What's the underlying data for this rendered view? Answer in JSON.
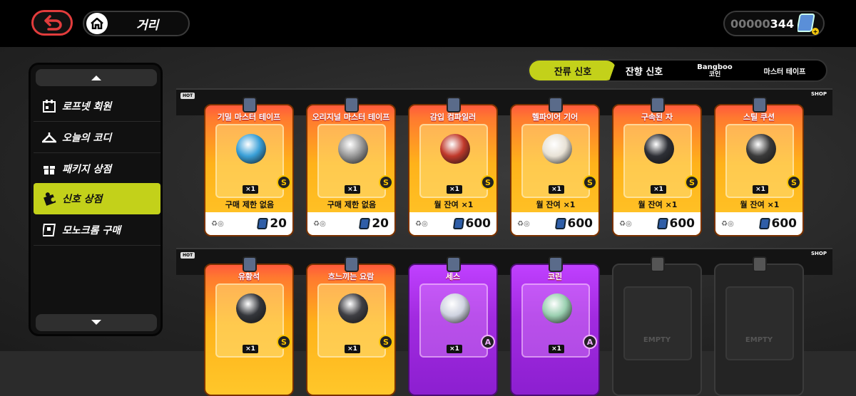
{
  "header": {
    "location": "거리",
    "currency_zeros": "00000",
    "currency_value": "344"
  },
  "sidebar": {
    "items": [
      {
        "label": "로프넷 회원",
        "icon": "calendar-icon"
      },
      {
        "label": "오늘의 코디",
        "icon": "hanger-icon"
      },
      {
        "label": "패키지 상점",
        "icon": "gift-icon"
      },
      {
        "label": "신호 상점",
        "icon": "puzzle-icon",
        "active": true
      },
      {
        "label": "모노크롬 구매",
        "icon": "card-icon"
      }
    ]
  },
  "tabs": [
    {
      "label": "잔류 신호",
      "active": true
    },
    {
      "label": "잔향 신호"
    },
    {
      "label": "Bangboo",
      "sub": "코인"
    },
    {
      "label": "마스터 테이프"
    }
  ],
  "shelves": [
    {
      "hot": "HOT",
      "shop": "SHOP"
    },
    {
      "hot": "HOT",
      "shop": "SHOP"
    }
  ],
  "row1": [
    {
      "title": "기밀 마스터 테이프",
      "qty": "×1",
      "limit": "구매 제한 없음",
      "price": "20",
      "badge": "S",
      "color": "#3aa0d8"
    },
    {
      "title": "오리지널 마스터 테이프",
      "qty": "×1",
      "limit": "구매 제한 없음",
      "price": "20",
      "badge": "S",
      "color": "#999999"
    },
    {
      "title": "감입 컴파일러",
      "qty": "×1",
      "limit": "월 잔여 ×1",
      "price": "600",
      "badge": "S",
      "color": "#c0392b"
    },
    {
      "title": "헬파이어 기어",
      "qty": "×1",
      "limit": "월 잔여 ×1",
      "price": "600",
      "badge": "S",
      "color": "#e8e2d6"
    },
    {
      "title": "구속된 자",
      "qty": "×1",
      "limit": "월 잔여 ×1",
      "price": "600",
      "badge": "S",
      "color": "#2d2f35"
    },
    {
      "title": "스틸 쿠션",
      "qty": "×1",
      "limit": "월 잔여 ×1",
      "price": "600",
      "badge": "S",
      "color": "#3a3a3a"
    }
  ],
  "row2": [
    {
      "title": "유황석",
      "qty": "×1",
      "badge": "S",
      "color": "#34363b"
    },
    {
      "title": "흐느끼는 요람",
      "qty": "×1",
      "badge": "S",
      "color": "#3f3f44"
    },
    {
      "title": "세스",
      "qty": "×1",
      "badge": "A",
      "color": "#cfd3e0"
    },
    {
      "title": "코린",
      "qty": "×1",
      "badge": "A",
      "color": "#9ad0b0"
    }
  ],
  "empty_label": "EMPTY"
}
